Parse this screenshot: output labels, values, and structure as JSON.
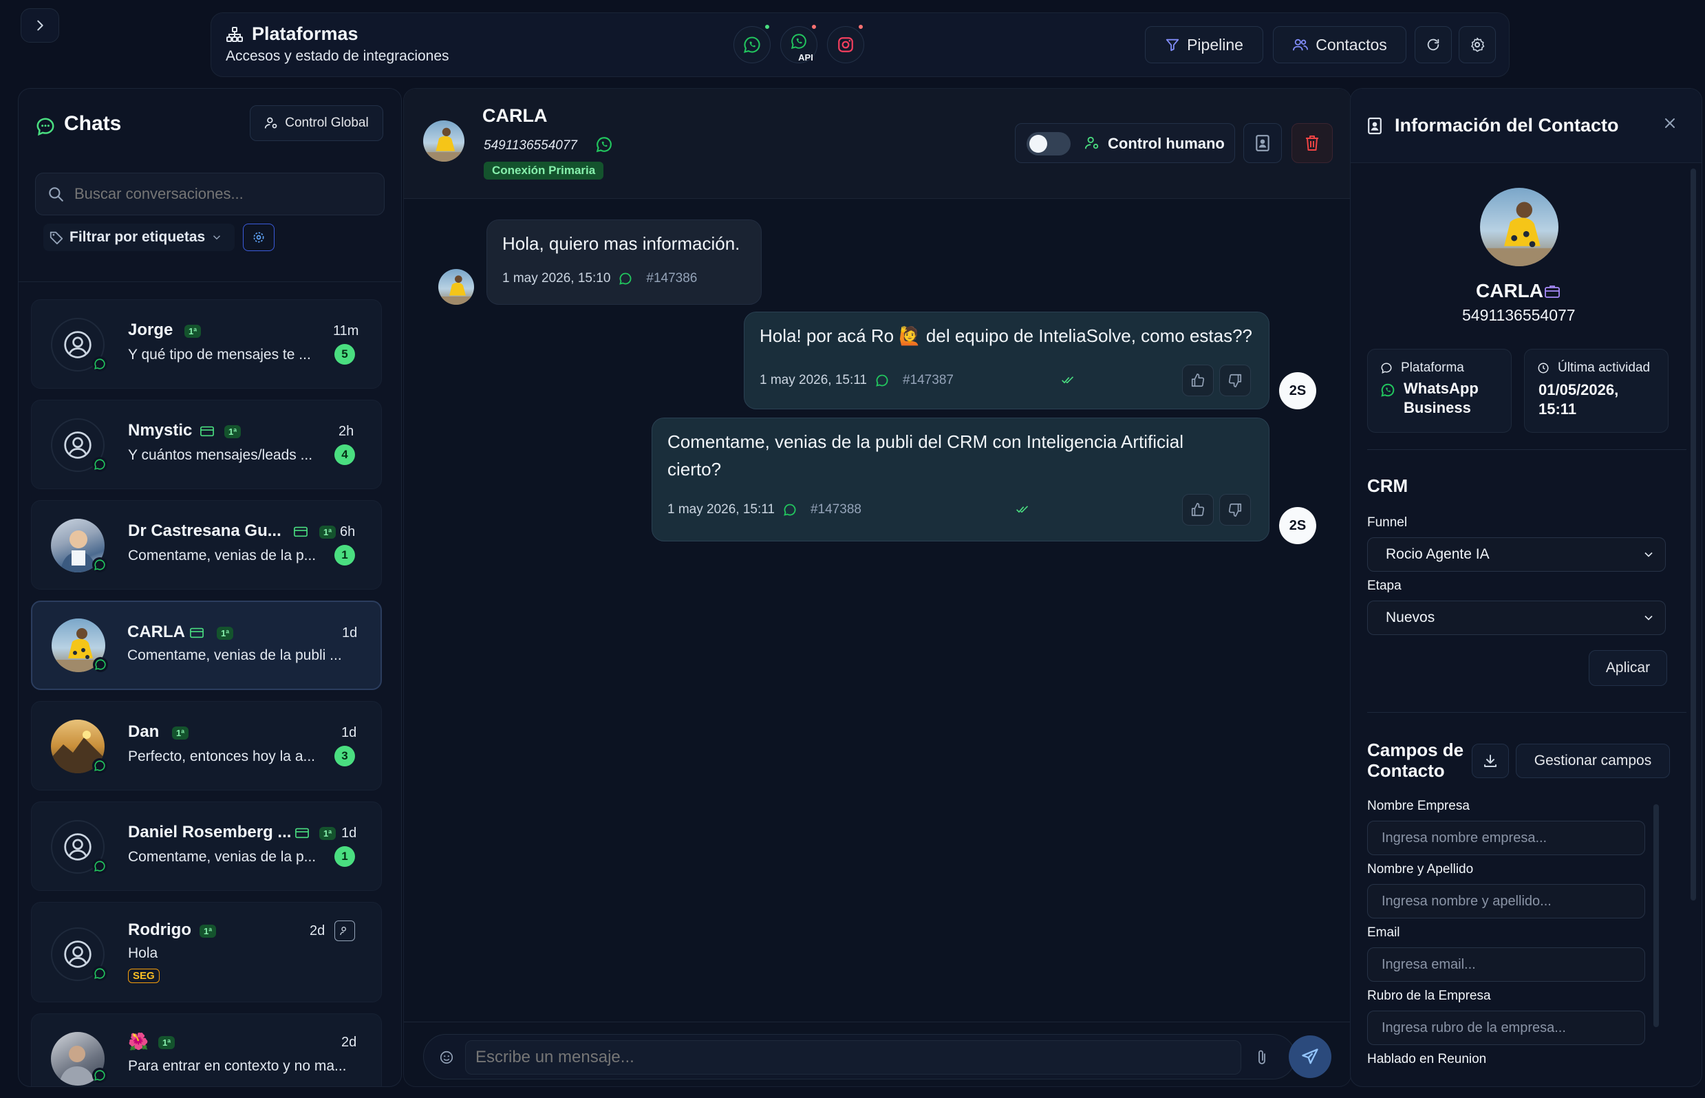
{
  "topbar": {
    "title": "Plataformas",
    "subtitle": "Accesos y estado de integraciones",
    "api_label": "API",
    "pipeline_label": "Pipeline",
    "contacts_label": "Contactos"
  },
  "chats": {
    "title": "Chats",
    "global_control_label": "Control Global",
    "search_placeholder": "Buscar conversaciones...",
    "filter_label": "Filtrar por etiquetas",
    "tag_first": "1ª",
    "items": [
      {
        "name": "Jorge",
        "preview": "Y qué tipo de mensajes te ...",
        "time": "11m",
        "unread": "5"
      },
      {
        "name": "Nmystic",
        "preview": "Y cuántos mensajes/leads ...",
        "time": "2h",
        "unread": "4"
      },
      {
        "name": "Dr Castresana Gu...",
        "preview": "Comentame, venias de la p...",
        "time": "6h",
        "unread": "1"
      },
      {
        "name": "CARLA",
        "preview": "Comentame, venias de la publi ...",
        "time": "1d",
        "unread": ""
      },
      {
        "name": "Dan",
        "preview": "Perfecto, entonces hoy la a...",
        "time": "1d",
        "unread": "3"
      },
      {
        "name": "Daniel Rosemberg ...",
        "preview": "Comentame, venias de la p...",
        "time": "1d",
        "unread": "1"
      },
      {
        "name": "Rodrigo",
        "preview": "Hola",
        "time": "2d",
        "unread": "",
        "label": "SEG"
      },
      {
        "name": "🌺",
        "preview": "Para entrar en contexto y no ma...",
        "time": "2d",
        "unread": ""
      }
    ]
  },
  "conversation": {
    "contact_name": "CARLA",
    "phone": "5491136554077",
    "connection_badge": "Conexión Primaria",
    "human_control_label": "Control humano",
    "composer_placeholder": "Escribe un mensaje...",
    "bot_initials": "2S",
    "messages": [
      {
        "direction": "in",
        "text": "Hola, quiero mas información.",
        "time": "1 may 2026, 15:10",
        "id": "#147386"
      },
      {
        "direction": "out",
        "text": "Hola! por acá Ro 🙋 del equipo de InteliaSolve, como estas??",
        "time": "1 may 2026, 15:11",
        "id": "#147387"
      },
      {
        "direction": "out",
        "text_line1": "Comentame, venias de la publi del CRM con Inteligencia Artificial",
        "text_line2": "cierto?",
        "time": "1 may 2026, 15:11",
        "id": "#147388"
      }
    ]
  },
  "contact_info": {
    "title": "Información del Contacto",
    "name": "CARLA",
    "phone": "5491136554077",
    "platform_label": "Plataforma",
    "platform_value_1": "WhatsApp",
    "platform_value_2": "Business",
    "last_activity_label": "Última actividad",
    "last_activity_value_1": "01/05/2026,",
    "last_activity_value_2": "15:11",
    "crm_title": "CRM",
    "funnel_label": "Funnel",
    "funnel_value": "Rocio Agente IA",
    "stage_label": "Etapa",
    "stage_value": "Nuevos",
    "apply_label": "Aplicar",
    "fields_title_1": "Campos de",
    "fields_title_2": "Contacto",
    "manage_fields_label": "Gestionar campos",
    "fields": [
      {
        "label": "Nombre Empresa",
        "placeholder": "Ingresa nombre empresa..."
      },
      {
        "label": "Nombre y Apellido",
        "placeholder": "Ingresa nombre y apellido..."
      },
      {
        "label": "Email",
        "placeholder": "Ingresa email..."
      },
      {
        "label": "Rubro de la Empresa",
        "placeholder": "Ingresa rubro de la empresa..."
      }
    ],
    "next_field_label": "Hablado en Reunion"
  },
  "colors": {
    "background": "#0b1120",
    "accent_green": "#4ade80",
    "whatsapp": "#22c55e",
    "danger": "#ef4444",
    "seg_tag": "#f59e0b"
  }
}
